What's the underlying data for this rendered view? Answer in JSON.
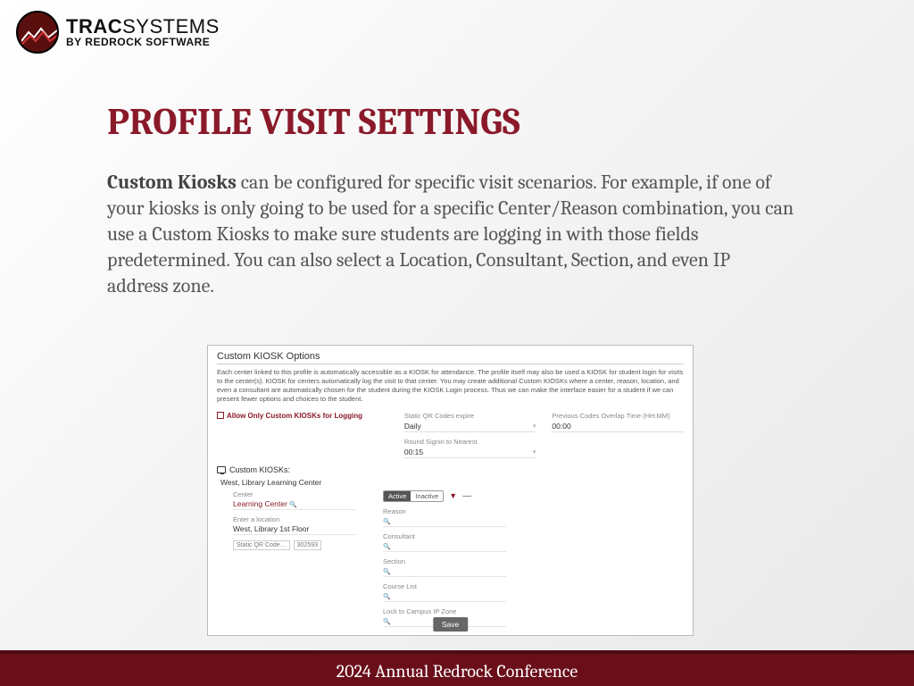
{
  "logo": {
    "main_a": "TRAC",
    "main_b": "SYSTEMS",
    "sub": "BY REDROCK SOFTWARE"
  },
  "title": "PROFILE VISIT SETTINGS",
  "body": {
    "lead": "Custom Kiosks",
    "rest": " can be configured for specific visit scenarios. For example, if one of your kiosks is only going to be used for a specific Center/Reason combination, you can use a Custom Kiosks to make sure students are logging in with those fields predetermined. You can also select a Location, Consultant, Section, and even IP address zone."
  },
  "panel": {
    "title": "Custom KIOSK Options",
    "desc": "Each center linked to this profile is automatically accessible as a KIOSK for attendance. The profile itself may also be used a KIOSK for student login for visits to the center(s). KIOSK for centers automatically log the visit to that center. You may create additional Custom KIOSKs where a center, reason, location, and even a consultant are automatically chosen for the student during the KIOSK Login process. Thus we can make the interface easier for a student if we can present fewer options and choices to the student.",
    "allow_only_label": "Allow Only Custom KIOSKs for Logging",
    "qr_expire_label": "Static QR Codes expire",
    "qr_expire_value": "Daily",
    "overlap_label": "Previous Codes Overlap Time (HH:MM)",
    "overlap_value": "00:00",
    "round_label": "Round Signin to Nearest",
    "round_value": "00:15",
    "kiosks_header": "Custom KIOSKs:",
    "kiosk_name": "West, Library Learning Center",
    "toggle_active": "Active",
    "toggle_inactive": "Inactive",
    "fields_left": {
      "center_label": "Center",
      "center_value": "Learning Center",
      "location_label": "Enter a location",
      "location_value": "West, Library 1st Floor",
      "qr_label": "Static QR Code…",
      "qr_value": "302593"
    },
    "fields_right": {
      "reason": "Reason",
      "consultant": "Consultant",
      "section": "Section",
      "course": "Course List",
      "ipzone": "Lock to Campus IP Zone"
    },
    "save": "Save"
  },
  "footer": "2024 Annual Redrock Conference"
}
